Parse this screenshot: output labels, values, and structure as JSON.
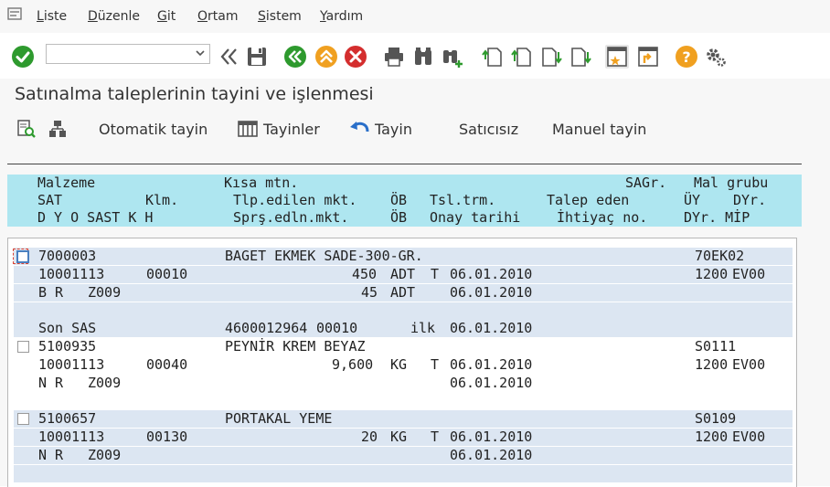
{
  "menu": [
    "Liste",
    "Düzenle",
    "Git",
    "Ortam",
    "Sistem",
    "Yardım"
  ],
  "toolbar": {
    "command_value": ""
  },
  "title": "Satınalma taleplerinin tayini ve işlenmesi",
  "app_toolbar": {
    "auto_assign": "Otomatik tayin",
    "assignments": "Tayinler",
    "assign": "Tayin",
    "no_vendor": "Satıcısız",
    "manual_assign": "Manuel tayin"
  },
  "header": {
    "row1": {
      "c1": "Malzeme",
      "c2": "Kısa mtn.",
      "c3": "SAGr.",
      "c4": "Mal grubu"
    },
    "row2": {
      "c1": "SAT",
      "c2": "Klm.",
      "c3": "Tlp.edilen mkt.",
      "c4": "ÖB",
      "c5": "Tsl.trm.",
      "c6": "Talep eden",
      "c7": "ÜY",
      "c8": "DYr."
    },
    "row3": {
      "c1": "D Y O SAST K H",
      "c2": "Sprş.edln.mkt.",
      "c3": "ÖB",
      "c4": "Onay tarihi",
      "c5": "İhtiyaç no.",
      "c6": "DYr. MİP"
    }
  },
  "items": [
    {
      "material": "7000003",
      "short_text": "BAGET EKMEK SADE-300-GR.",
      "mat_group": "70EK02",
      "pr": "10001113",
      "item": "00010",
      "qty": "450",
      "unit": "ADT",
      "t": "T",
      "deliv_date": "06.01.2010",
      "plant": "1200",
      "stor": "EV00",
      "d": "B",
      "y": "R",
      "sast": "Z009",
      "ord_qty": "45",
      "ord_unit": "ADT",
      "approval_date": "06.01.2010"
    },
    {
      "last_label": "Son SAS",
      "last_po": "4600012964",
      "last_item": "00010",
      "last_flag": "ilk",
      "last_date": "06.01.2010"
    },
    {
      "material": "5100935",
      "short_text": "PEYNİR KREM BEYAZ",
      "mat_group": "S0111",
      "pr": "10001113",
      "item": "00040",
      "qty": "9,600",
      "unit": "KG",
      "t": "T",
      "deliv_date": "06.01.2010",
      "plant": "1200",
      "stor": "EV00",
      "d": "N",
      "y": "R",
      "sast": "Z009",
      "approval_date": "06.01.2010"
    },
    {
      "material": "5100657",
      "short_text": "PORTAKAL YEME",
      "mat_group": "S0109",
      "pr": "10001113",
      "item": "00130",
      "qty": "20",
      "unit": "KG",
      "t": "T",
      "deliv_date": "06.01.2010",
      "plant": "1200",
      "stor": "EV00",
      "d": "N",
      "y": "R",
      "sast": "Z009",
      "approval_date": "06.01.2010"
    }
  ],
  "colors": {
    "header_bg": "#aee6f0",
    "row_blue": "#dce6f2",
    "bg": "#f7f7f7"
  }
}
